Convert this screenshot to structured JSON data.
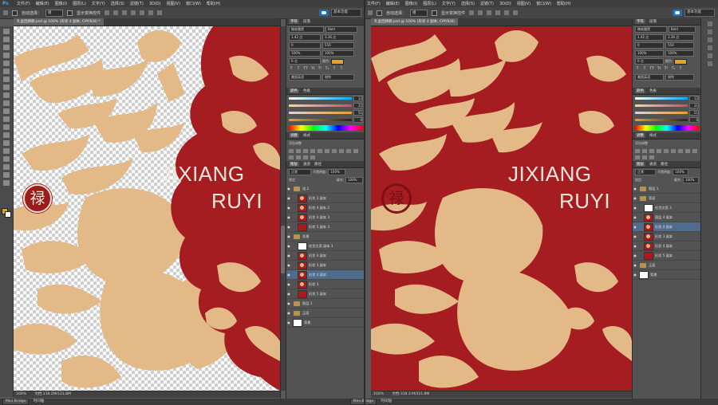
{
  "app": {
    "logo": "Ps",
    "menu": [
      "文件(F)",
      "编辑(E)",
      "图像(I)",
      "图层(L)",
      "文字(Y)",
      "选择(S)",
      "滤镜(T)",
      "3D(D)",
      "视图(V)",
      "窗口(W)",
      "帮助(H)"
    ]
  },
  "options": {
    "auto_select_label": "自动选择：",
    "auto_select_value": "组",
    "transform_label": "显示变换控件",
    "workspace": "基本功能"
  },
  "left": {
    "doc_tab": "礼盒回顾稿.psd @ 100% (形状 4 副本, CMYK/8) *",
    "status_zoom": "100%",
    "status_doc": "文档:118.2M/121.8M",
    "mini_bridge": "Mini Bridge",
    "timeline": "时间轴"
  },
  "right": {
    "doc_tab": "礼盒回顾稿.psd @ 100% (形状 4 副本, CMYK/8)",
    "status_zoom": "100%",
    "status_doc": "文档:318.3 M/321.8M",
    "mini_bridge": "Mini Bridge",
    "timeline": "时间轴"
  },
  "artwork": {
    "line1": "JIXIANG",
    "line2": "RUYI",
    "stamp_char": "禄"
  },
  "colors": {
    "red": "#a51c21",
    "tan": "#e2b987",
    "accent": "#e7a02a"
  },
  "character_panel": {
    "tabs": [
      "字符",
      "段落"
    ],
    "font": "微软雅黑",
    "style": "Bold",
    "size": "1.42 点",
    "leading": "3.36 点",
    "kerning": "0",
    "tracking": "550",
    "scale_v": "100%",
    "scale_h": "100%",
    "baseline": "0 点",
    "color_label": "颜色:",
    "lang": "美国英语",
    "aa": "锐利"
  },
  "color_panel": {
    "tabs": [
      "颜色",
      "色板"
    ],
    "c": "12",
    "m": "31",
    "y": "51",
    "k": "0"
  },
  "adjust_panel": {
    "tabs": [
      "调整",
      "样式"
    ],
    "add_label": "添加调整"
  },
  "layers_panel": {
    "tabs": [
      "图层",
      "通道",
      "路径"
    ],
    "kind": "正常",
    "opacity_label": "不透明度:",
    "opacity": "100%",
    "lock_label": "锁定:",
    "fill_label": "填充:",
    "fill": "100%",
    "left_layers": [
      {
        "name": "组 2",
        "type": "group",
        "indent": 0
      },
      {
        "name": "形状 3 副本",
        "type": "pat",
        "indent": 1
      },
      {
        "name": "形状 4 副本 2",
        "type": "pat",
        "indent": 1
      },
      {
        "name": "形状 4 副本 3",
        "type": "pat",
        "indent": 1
      },
      {
        "name": "形状 5 副本 3",
        "type": "red",
        "indent": 1
      },
      {
        "name": "背景",
        "type": "group",
        "indent": 0
      },
      {
        "name": "吃货文案 副本 3",
        "type": "mask",
        "indent": 1
      },
      {
        "name": "形状 4 副本",
        "type": "pat",
        "indent": 1
      },
      {
        "name": "形状 3 副本",
        "type": "pat",
        "indent": 1
      },
      {
        "name": "形状 4 副本",
        "type": "pat",
        "indent": 1,
        "selected": true
      },
      {
        "name": "形状 3",
        "type": "pat",
        "indent": 1
      },
      {
        "name": "形状 5 副本",
        "type": "red",
        "indent": 1
      },
      {
        "name": "图层 1",
        "type": "group",
        "indent": 0
      },
      {
        "name": "正面",
        "type": "group",
        "indent": 0
      },
      {
        "name": "背景",
        "type": "mask",
        "indent": 0
      }
    ],
    "right_layers": [
      {
        "name": "图层 1",
        "type": "group",
        "indent": 0
      },
      {
        "name": "背面",
        "type": "group",
        "indent": 0
      },
      {
        "name": "吃货文案 3",
        "type": "mask",
        "indent": 1
      },
      {
        "name": "图层 4 副本",
        "type": "pat",
        "indent": 1
      },
      {
        "name": "形状 4 副本",
        "type": "pat",
        "indent": 1,
        "selected": true
      },
      {
        "name": "形状 3 副本",
        "type": "pat",
        "indent": 1
      },
      {
        "name": "形状 4 副本",
        "type": "pat",
        "indent": 1
      },
      {
        "name": "形状 5 副本",
        "type": "red",
        "indent": 1
      },
      {
        "name": "正面",
        "type": "group",
        "indent": 0
      },
      {
        "name": "背景",
        "type": "mask",
        "indent": 0
      }
    ]
  }
}
